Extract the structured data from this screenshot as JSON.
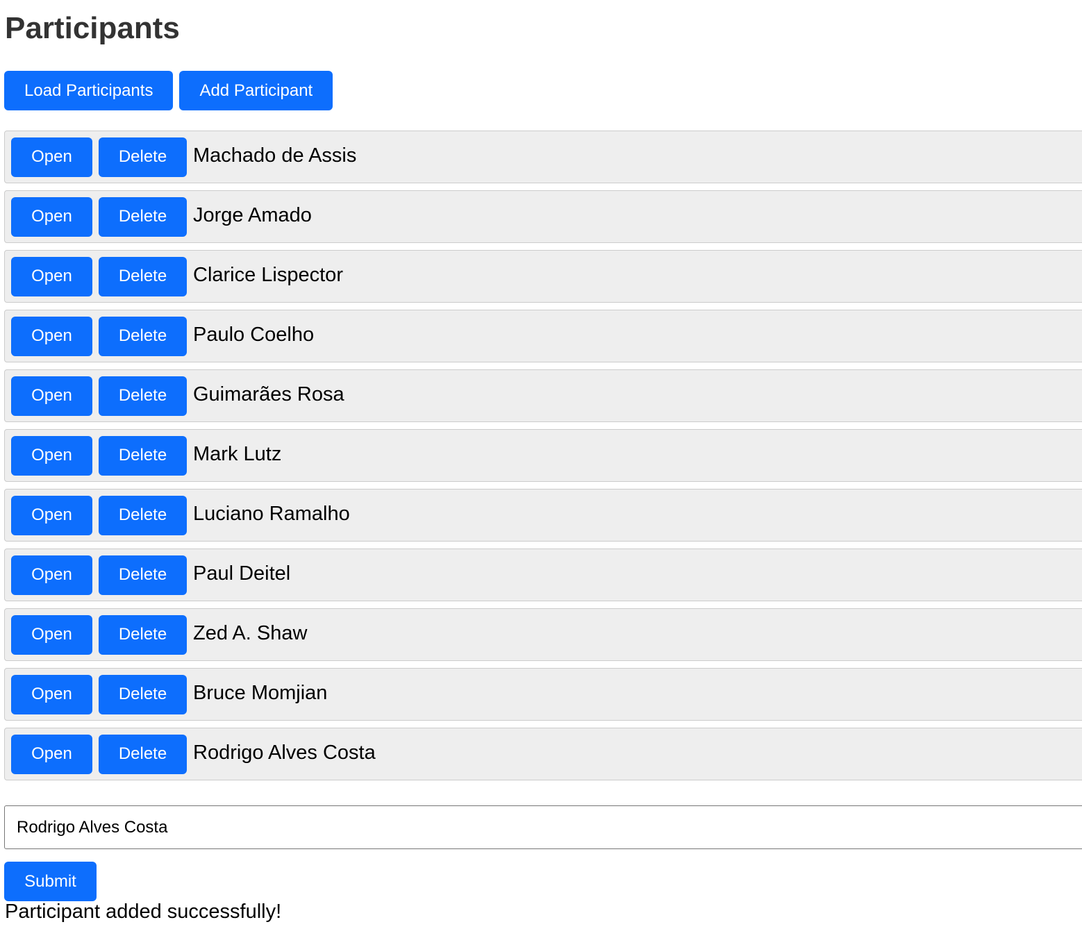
{
  "page": {
    "title": "Participants"
  },
  "toolbar": {
    "load_label": "Load Participants",
    "add_label": "Add Participant"
  },
  "participants": [
    {
      "name": "Machado de Assis",
      "open_label": "Open",
      "delete_label": "Delete"
    },
    {
      "name": "Jorge Amado",
      "open_label": "Open",
      "delete_label": "Delete"
    },
    {
      "name": "Clarice Lispector",
      "open_label": "Open",
      "delete_label": "Delete"
    },
    {
      "name": "Paulo Coelho",
      "open_label": "Open",
      "delete_label": "Delete"
    },
    {
      "name": "Guimarães Rosa",
      "open_label": "Open",
      "delete_label": "Delete"
    },
    {
      "name": "Mark Lutz",
      "open_label": "Open",
      "delete_label": "Delete"
    },
    {
      "name": "Luciano Ramalho",
      "open_label": "Open",
      "delete_label": "Delete"
    },
    {
      "name": "Paul Deitel",
      "open_label": "Open",
      "delete_label": "Delete"
    },
    {
      "name": "Zed A. Shaw",
      "open_label": "Open",
      "delete_label": "Delete"
    },
    {
      "name": "Bruce Momjian",
      "open_label": "Open",
      "delete_label": "Delete"
    },
    {
      "name": "Rodrigo Alves Costa",
      "open_label": "Open",
      "delete_label": "Delete"
    }
  ],
  "form": {
    "name_value": "Rodrigo Alves Costa",
    "submit_label": "Submit"
  },
  "status": {
    "message": "Participant added successfully!"
  },
  "colors": {
    "button_bg": "#0d6efd",
    "button_text": "#ffffff",
    "row_bg": "#eeeeee",
    "title_text": "#333333"
  }
}
